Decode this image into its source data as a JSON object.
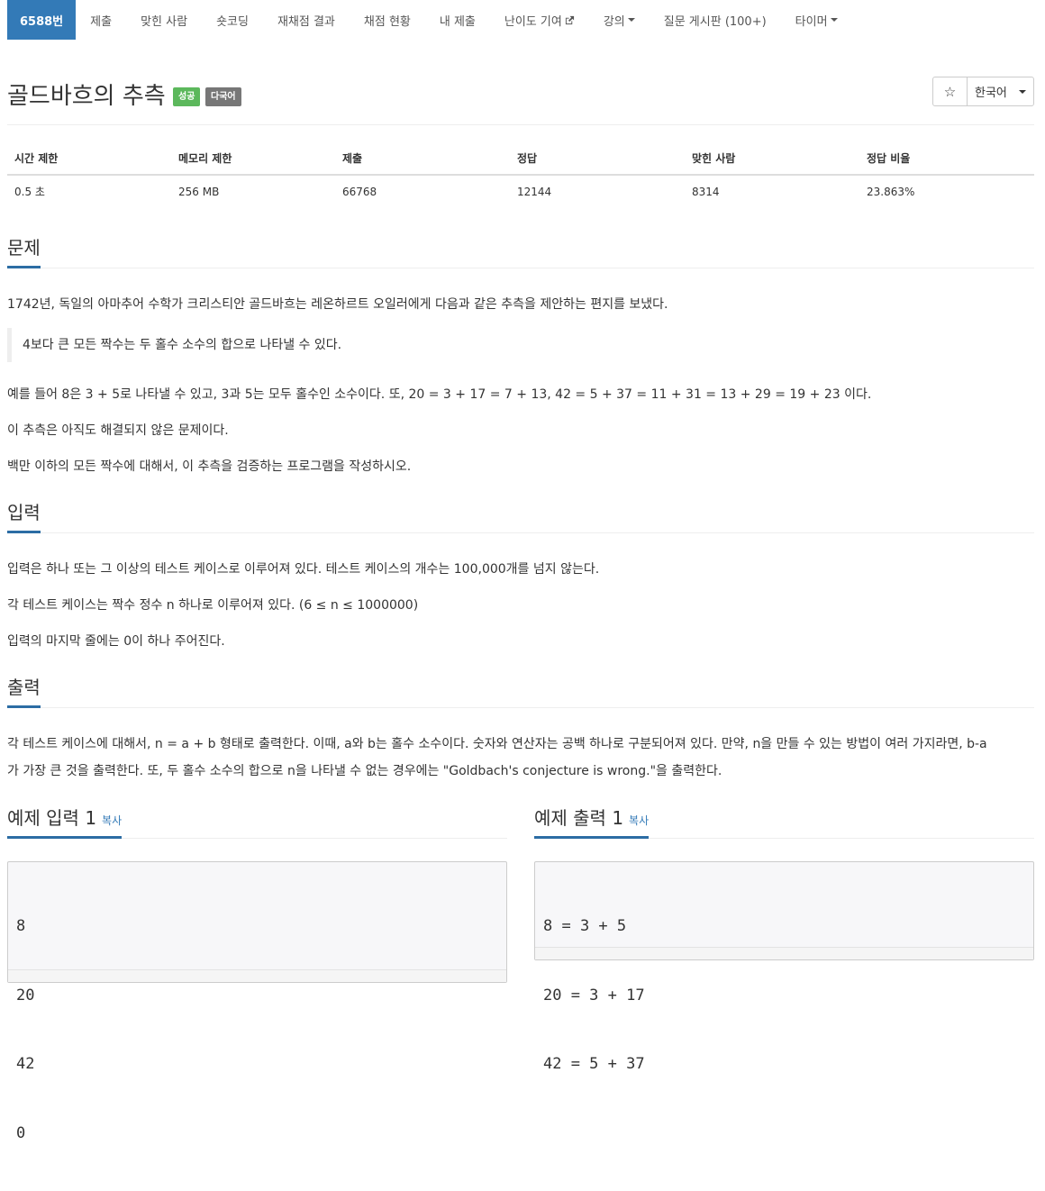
{
  "nav": {
    "items": [
      {
        "label": "6588번"
      },
      {
        "label": "제출"
      },
      {
        "label": "맞힌 사람"
      },
      {
        "label": "숏코딩"
      },
      {
        "label": "재채점 결과"
      },
      {
        "label": "채점 현황"
      },
      {
        "label": "내 제출"
      },
      {
        "label": "난이도 기여"
      },
      {
        "label": "강의"
      },
      {
        "label": "질문 게시판 (100+)"
      },
      {
        "label": "타이머"
      }
    ]
  },
  "problem": {
    "title": "골드바흐의 추측",
    "label_success": "성공",
    "label_multilang": "다국어",
    "star": "☆",
    "language": "한국어"
  },
  "info": {
    "headers": [
      "시간 제한",
      "메모리 제한",
      "제출",
      "정답",
      "맞힌 사람",
      "정답 비율"
    ],
    "values": [
      "0.5 초",
      "256 MB",
      "66768",
      "12144",
      "8314",
      "23.863%"
    ]
  },
  "description": {
    "heading": "문제",
    "p1": "1742년, 독일의 아마추어 수학가 크리스티안 골드바흐는 레온하르트 오일러에게 다음과 같은 추측을 제안하는 편지를 보냈다.",
    "quote": "4보다 큰 모든 짝수는 두 홀수 소수의 합으로 나타낼 수 있다.",
    "p2": "예를 들어 8은 3 + 5로 나타낼 수 있고, 3과 5는 모두 홀수인 소수이다. 또, 20 = 3 + 17 = 7 + 13, 42 = 5 + 37 = 11 + 31 = 13 + 29 = 19 + 23 이다.",
    "p3": "이 추측은 아직도 해결되지 않은 문제이다.",
    "p4": "백만 이하의 모든 짝수에 대해서, 이 추측을 검증하는 프로그램을 작성하시오."
  },
  "input": {
    "heading": "입력",
    "p1": "입력은 하나 또는 그 이상의 테스트 케이스로 이루어져 있다. 테스트 케이스의 개수는 100,000개를 넘지 않는다.",
    "p2": "각 테스트 케이스는 짝수 정수 n 하나로 이루어져 있다. (6 ≤ n ≤ 1000000)",
    "p3": "입력의 마지막 줄에는 0이 하나 주어진다."
  },
  "output": {
    "heading": "출력",
    "p1_line1": "각 테스트 케이스에 대해서, n = a + b 형태로 출력한다. 이때, a와 b는 홀수 소수이다. 숫자와 연산자는 공백 하나로 구분되어져 있다. 만약, n을 만들 수 있는 방법이 여러 가지라면, b-a",
    "p1_line2": "가 가장 큰 것을 출력한다. 또, 두 홀수 소수의 합으로 n을 나타낼 수 없는 경우에는 \"Goldbach's conjecture is wrong.\"을 출력한다."
  },
  "samples": {
    "input_heading": "예제 입력 1",
    "output_heading": "예제 출력 1",
    "copy_label": "복사",
    "input_lines": [
      "8",
      "20",
      "42",
      "0"
    ],
    "output_lines": [
      "8 = 3 + 5",
      "20 = 3 + 17",
      "42 = 5 + 37"
    ]
  },
  "colors": {
    "primary": "#337ab7",
    "success": "#5cb85c",
    "default_label": "#777777"
  }
}
